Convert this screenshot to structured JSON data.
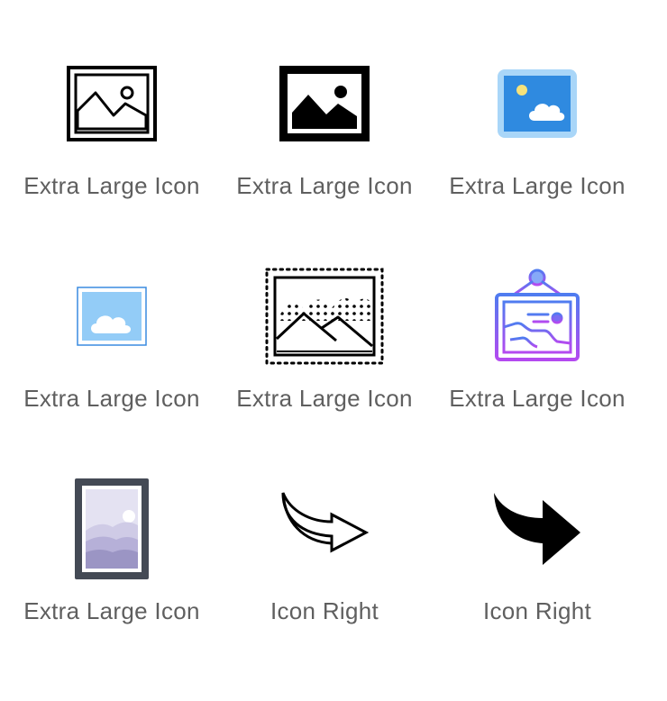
{
  "items": [
    {
      "label": "Extra Large Icon",
      "icon": "picture-frame-outline-icon"
    },
    {
      "label": "Extra Large Icon",
      "icon": "picture-frame-filled-icon"
    },
    {
      "label": "Extra Large Icon",
      "icon": "image-cloud-sun-color-icon"
    },
    {
      "label": "Extra Large Icon",
      "icon": "image-cloud-light-icon"
    },
    {
      "label": "Extra Large Icon",
      "icon": "picture-dotted-frame-icon"
    },
    {
      "label": "Extra Large Icon",
      "icon": "hanging-picture-gradient-icon"
    },
    {
      "label": "Extra Large Icon",
      "icon": "framed-landscape-photo-icon"
    },
    {
      "label": "Icon Right",
      "icon": "curved-arrow-right-outline-icon"
    },
    {
      "label": "Icon Right",
      "icon": "curved-arrow-right-filled-icon"
    }
  ],
  "colors": {
    "label_text": "#5f5f5f",
    "blue_tile": "#2f8ae0",
    "blue_tile_border": "#a9d6f8",
    "light_blue_tile": "#93ccf7",
    "light_blue_border": "#3a8be0",
    "sun_yellow": "#f7e27a",
    "gradient_top": "#4f7cf0",
    "gradient_bottom": "#b44af0",
    "frame_gray": "#444a55",
    "mountain_purple": "#9b95c4"
  }
}
